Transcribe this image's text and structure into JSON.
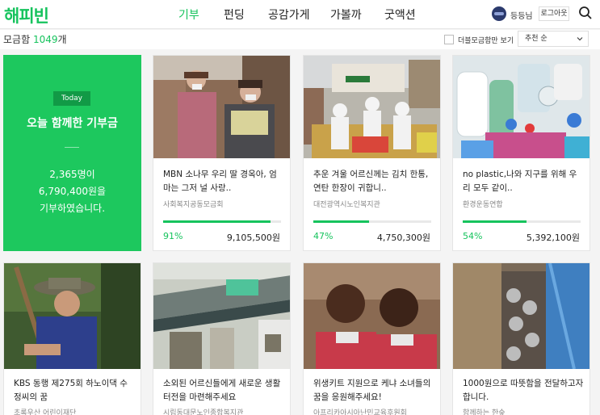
{
  "header": {
    "logo": "해피빈",
    "nav": [
      "기부",
      "펀딩",
      "공감가게",
      "가볼까",
      "굿액션"
    ],
    "user": "등등님",
    "logout": "로그아웃"
  },
  "subheader": {
    "count_prefix": "모금함 ",
    "count_value": "1049",
    "count_suffix": "개",
    "double_only": "더블모금함만 보기",
    "sort": "추천 순"
  },
  "today": {
    "badge": "Today",
    "title": "오늘 함께한 기부금",
    "line1": "2,365명이",
    "line2": "6,790,400원을",
    "line3": "기부하였습니다."
  },
  "cards": [
    {
      "title": "MBN 소나무 우리 딸 경옥아, 엄마는 그저 널 사랑..",
      "org": "사회복지공동모금회",
      "percent": "91%",
      "progress": 0.91,
      "amount": "9,105,500원"
    },
    {
      "title": "추운 겨울 어르신께는 김치 한통, 연탄 한장이 귀합니..",
      "org": "대전광역시노인복지관",
      "percent": "47%",
      "progress": 0.47,
      "amount": "4,750,300원"
    },
    {
      "title": "no plastic,나와 지구를 위해 우리 모두 같이..",
      "org": "환경운동연합",
      "percent": "54%",
      "progress": 0.54,
      "amount": "5,392,100원"
    },
    {
      "title": "KBS 동행 제275회 하노이댁 수정씨의 꿈",
      "org": "초록우산 어린이재단"
    },
    {
      "title": "소외된 어르신들에게 새로운 생활터전을 마련해주세요",
      "org": "시립동대문노인종합복지관"
    },
    {
      "title": "위생키트 지원으로 케냐 소녀들의 꿈을 응원해주세요!",
      "org": "아프리카아시아난민교육후원회"
    },
    {
      "title": "1000원으로 따뜻함을 전달하고자 합니다.",
      "org": "함께하는 한숲"
    }
  ],
  "colors": {
    "brand": "#16c35d",
    "today_bg": "#1dc85e"
  }
}
